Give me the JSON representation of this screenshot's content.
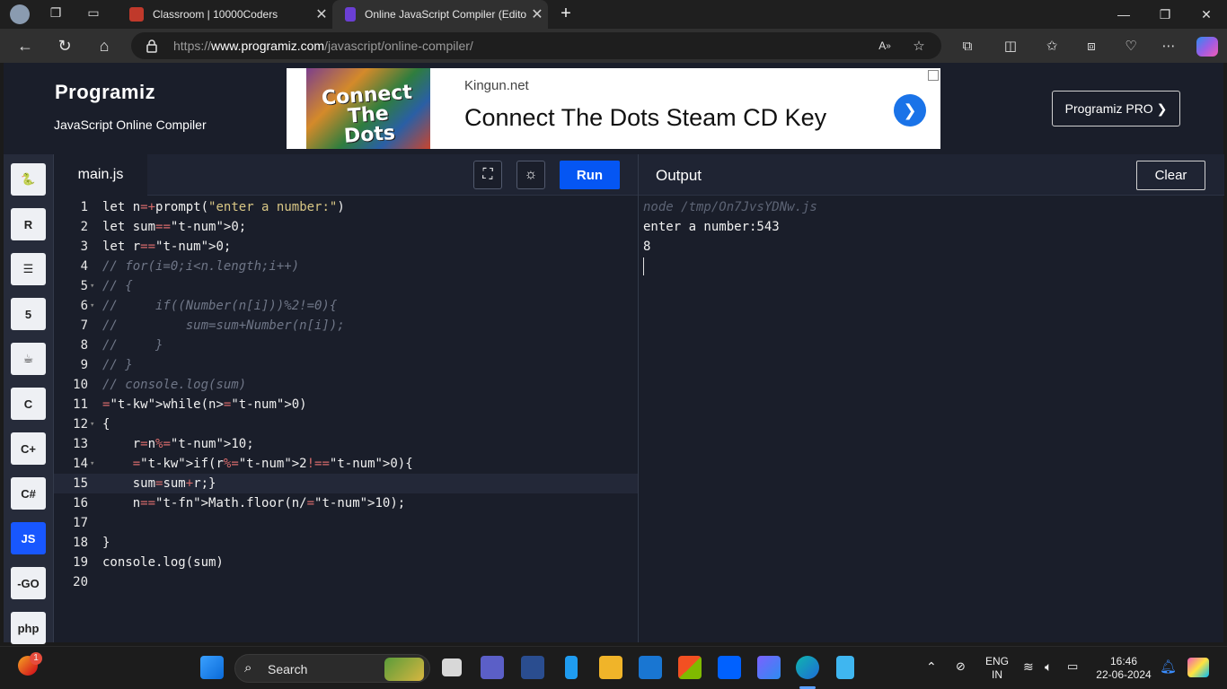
{
  "browser": {
    "tabs": [
      {
        "title": "Classroom | 10000Coders",
        "active": false
      },
      {
        "title": "Online JavaScript Compiler (Edito",
        "active": true
      }
    ],
    "url_prefix": "https://",
    "url_domain": "www.programiz.com",
    "url_path": "/javascript/online-compiler/"
  },
  "site": {
    "logo": "Programiz",
    "subtitle": "JavaScript Online Compiler",
    "pro_button": "Programiz PRO ❯"
  },
  "ad": {
    "image_text": "Connect The Dots",
    "domain": "Kingun.net",
    "title": "Connect The Dots Steam CD Key"
  },
  "languages": [
    {
      "name": "python-icon",
      "label": "🐍",
      "active": false
    },
    {
      "name": "r-icon",
      "label": "R",
      "active": false
    },
    {
      "name": "sql-icon",
      "label": "☰",
      "active": false
    },
    {
      "name": "html-icon",
      "label": "5",
      "active": false
    },
    {
      "name": "java-icon",
      "label": "☕",
      "active": false
    },
    {
      "name": "c-icon",
      "label": "C",
      "active": false
    },
    {
      "name": "cpp-icon",
      "label": "C+",
      "active": false
    },
    {
      "name": "csharp-icon",
      "label": "C#",
      "active": false
    },
    {
      "name": "js-icon",
      "label": "JS",
      "active": true
    },
    {
      "name": "go-icon",
      "label": "-GO",
      "active": false
    },
    {
      "name": "php-icon",
      "label": "php",
      "active": false
    }
  ],
  "editor": {
    "file_tab": "main.js",
    "run_label": "Run",
    "lines": [
      {
        "n": "1",
        "fold": "",
        "code": "let n=+prompt(\"enter a number:\")"
      },
      {
        "n": "2",
        "fold": "",
        "code": "let sum=0;"
      },
      {
        "n": "3",
        "fold": "",
        "code": "let r=0;"
      },
      {
        "n": "4",
        "fold": "",
        "code": "// for(i=0;i<n.length;i++)"
      },
      {
        "n": "5",
        "fold": "▾",
        "code": "// {"
      },
      {
        "n": "6",
        "fold": "▾",
        "code": "//     if((Number(n[i]))%2!=0){"
      },
      {
        "n": "7",
        "fold": "",
        "code": "//         sum=sum+Number(n[i]);"
      },
      {
        "n": "8",
        "fold": "",
        "code": "//     }"
      },
      {
        "n": "9",
        "fold": "",
        "code": "// }"
      },
      {
        "n": "10",
        "fold": "",
        "code": "// console.log(sum)"
      },
      {
        "n": "11",
        "fold": "",
        "code": "while(n>0)"
      },
      {
        "n": "12",
        "fold": "▾",
        "code": "{"
      },
      {
        "n": "13",
        "fold": "",
        "code": "    r=n%10;"
      },
      {
        "n": "14",
        "fold": "▾",
        "code": "    if(r%2!=0){"
      },
      {
        "n": "15",
        "fold": "",
        "code": "    sum=sum+r;}"
      },
      {
        "n": "16",
        "fold": "",
        "code": "    n=Math.floor(n/10);"
      },
      {
        "n": "17",
        "fold": "",
        "code": ""
      },
      {
        "n": "18",
        "fold": "",
        "code": "}"
      },
      {
        "n": "19",
        "fold": "",
        "code": "console.log(sum)"
      },
      {
        "n": "20",
        "fold": "",
        "code": ""
      }
    ]
  },
  "output": {
    "title": "Output",
    "clear_label": "Clear",
    "command": "node /tmp/On7JvsYDNw.js",
    "lines": [
      "enter a number:543",
      "8"
    ]
  },
  "taskbar": {
    "search_label": "Search",
    "lang_top": "ENG",
    "lang_bottom": "IN",
    "time": "16:46",
    "date": "22-06-2024",
    "notification_count": "1"
  },
  "colors": {
    "run_button": "#0556f3",
    "active_lang": "#1857ff",
    "editor_bg": "#1a1e2a"
  }
}
